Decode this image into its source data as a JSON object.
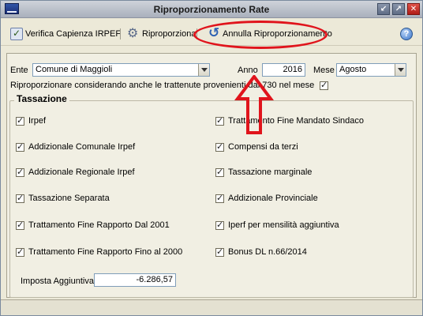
{
  "window": {
    "title": "Riproporzionamento Rate",
    "icon": "app-window-icon"
  },
  "titlebar_buttons": {
    "minimize": "↙",
    "maximize": "↗",
    "close": "✕"
  },
  "toolbar": {
    "verifica_label": "Verifica Capienza IRPEF",
    "riproporziona_label": "Riproporziona",
    "annulla_label": "Annulla Riproporzionamento",
    "help": "?"
  },
  "filters": {
    "ente_label": "Ente",
    "ente_value": "Comune di Maggioli",
    "anno_label": "Anno",
    "anno_value": "2016",
    "mese_label": "Mese",
    "mese_value": "Agosto"
  },
  "riproporzionare_option": {
    "label": "Riproporzionare considerando anche le trattenute provenienti dal 730 nel mese",
    "checked": true
  },
  "tassazione": {
    "title": "Tassazione",
    "left": [
      {
        "label": "Irpef",
        "checked": true
      },
      {
        "label": "Addizionale Comunale Irpef",
        "checked": true
      },
      {
        "label": "Addizionale Regionale Irpef",
        "checked": true
      },
      {
        "label": "Tassazione Separata",
        "checked": true
      },
      {
        "label": "Trattamento Fine Rapporto Dal 2001",
        "checked": true
      },
      {
        "label": "Trattamento Fine Rapporto Fino al 2000",
        "checked": true
      }
    ],
    "right": [
      {
        "label": "Trattamento Fine Mandato Sindaco",
        "checked": true
      },
      {
        "label": "Compensi da terzi",
        "checked": true
      },
      {
        "label": "Tassazione marginale",
        "checked": true
      },
      {
        "label": "Addizionale Provinciale",
        "checked": true
      },
      {
        "label": "Iperf per mensilità aggiuntiva",
        "checked": true
      },
      {
        "label": "Bonus DL n.66/2014",
        "checked": true
      }
    ],
    "imposta_label": "Imposta Aggiuntiva",
    "imposta_value": "-6.286,57"
  },
  "annotation": {
    "color": "#e0141c",
    "shapes": [
      "ellipse-highlight",
      "up-arrow"
    ]
  },
  "colors": {
    "window_bg": "#ece9d8",
    "panel_bg": "#f1efe3",
    "highlight": "#e0141c"
  }
}
